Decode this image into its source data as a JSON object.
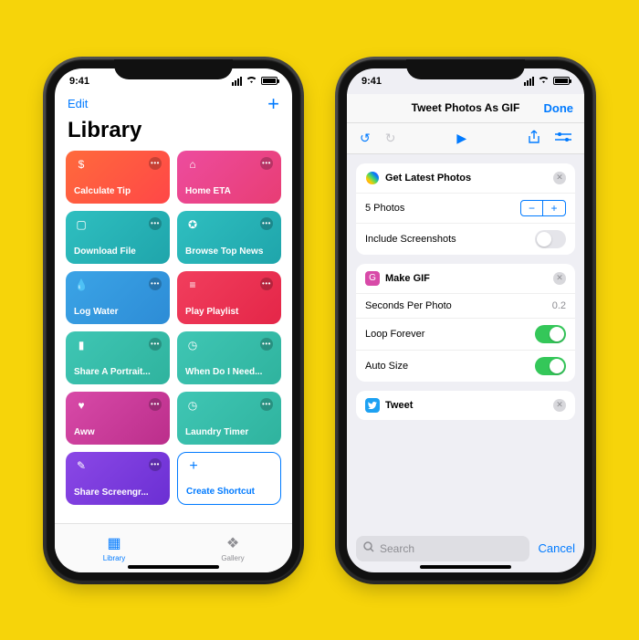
{
  "status": {
    "time": "9:41"
  },
  "phone1": {
    "nav": {
      "edit": "Edit"
    },
    "title": "Library",
    "tiles": [
      {
        "label": "Calculate Tip",
        "icon": "$",
        "grad": "g-orange"
      },
      {
        "label": "Home ETA",
        "icon": "⌂",
        "grad": "g-pink"
      },
      {
        "label": "Download File",
        "icon": "▢",
        "grad": "g-teal"
      },
      {
        "label": "Browse Top News",
        "icon": "✪",
        "grad": "g-teal"
      },
      {
        "label": "Log Water",
        "icon": "💧",
        "grad": "g-blue"
      },
      {
        "label": "Play Playlist",
        "icon": "≡",
        "grad": "g-red"
      },
      {
        "label": "Share A Portrait...",
        "icon": "▮",
        "grad": "g-green"
      },
      {
        "label": "When Do I Need...",
        "icon": "◷",
        "grad": "g-green"
      },
      {
        "label": "Aww",
        "icon": "♥",
        "grad": "g-magenta"
      },
      {
        "label": "Laundry Timer",
        "icon": "◷",
        "grad": "g-green"
      },
      {
        "label": "Share Screengr...",
        "icon": "✎",
        "grad": "g-purple"
      }
    ],
    "create": "Create Shortcut",
    "tabs": {
      "library": "Library",
      "gallery": "Gallery"
    }
  },
  "phone2": {
    "title": "Tweet Photos As GIF",
    "done": "Done",
    "action1": {
      "name": "Get Latest Photos",
      "count_label": "5 Photos",
      "screenshots_label": "Include Screenshots"
    },
    "action2": {
      "name": "Make GIF",
      "seconds_label": "Seconds Per Photo",
      "seconds_value": "0.2",
      "loop_label": "Loop Forever",
      "autosize_label": "Auto Size"
    },
    "action3": {
      "name": "Tweet"
    },
    "search": {
      "placeholder": "Search",
      "cancel": "Cancel"
    }
  }
}
